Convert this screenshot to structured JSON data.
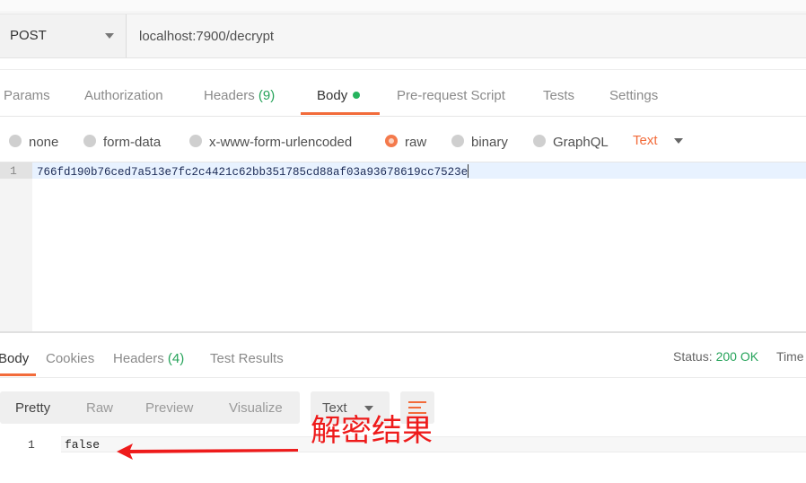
{
  "request": {
    "method": "POST",
    "url": "localhost:7900/decrypt"
  },
  "request_tabs": [
    {
      "label": "Params"
    },
    {
      "label": "Authorization"
    },
    {
      "label": "Headers",
      "count": "(9)"
    },
    {
      "label": "Body",
      "active": true,
      "indicator": "green-dot"
    },
    {
      "label": "Pre-request Script"
    },
    {
      "label": "Tests"
    },
    {
      "label": "Settings"
    }
  ],
  "body_types": [
    {
      "label": "none"
    },
    {
      "label": "form-data"
    },
    {
      "label": "x-www-form-urlencoded"
    },
    {
      "label": "raw",
      "selected": true
    },
    {
      "label": "binary"
    },
    {
      "label": "GraphQL"
    }
  ],
  "raw_format": "Text",
  "request_body": {
    "line_number": "1",
    "content": "766fd190b76ced7a513e7fc2c4421c62bb351785cd88af03a93678619cc7523e"
  },
  "response_tabs": [
    {
      "label": "Body",
      "active": true
    },
    {
      "label": "Cookies"
    },
    {
      "label": "Headers",
      "count": "(4)"
    },
    {
      "label": "Test Results"
    }
  ],
  "status": {
    "label": "Status:",
    "value": "200 OK",
    "time_label": "Time"
  },
  "view_modes": [
    {
      "label": "Pretty",
      "active": true
    },
    {
      "label": "Raw"
    },
    {
      "label": "Preview"
    },
    {
      "label": "Visualize"
    }
  ],
  "response_format": "Text",
  "response_body": {
    "line_number": "1",
    "content": "false"
  },
  "annotation": {
    "text": "解密结果",
    "color": "#ee1b1b"
  },
  "colors": {
    "accent": "#f26b3a",
    "success": "#26a35a"
  }
}
